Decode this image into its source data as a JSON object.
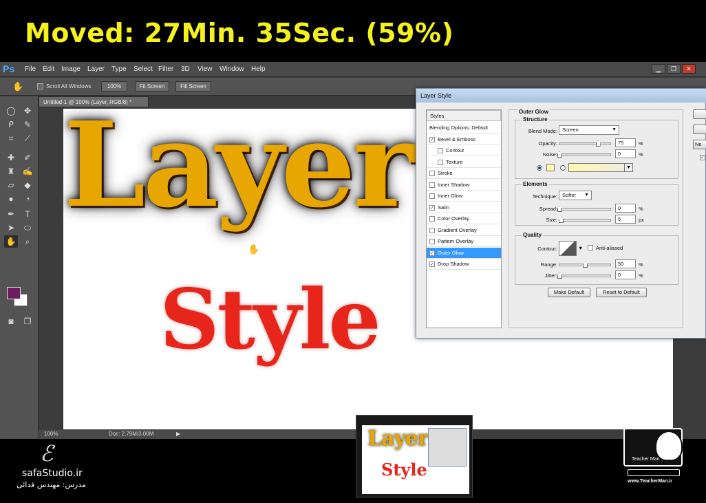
{
  "banner": {
    "text": "Moved: 27Min. 35Sec. (59%)"
  },
  "app": {
    "logo": "Ps",
    "menu": [
      "File",
      "Edit",
      "Image",
      "Layer",
      "Type",
      "Select",
      "Filter",
      "3D",
      "View",
      "Window",
      "Help"
    ],
    "window_buttons": [
      "▁",
      "❐",
      "✕"
    ]
  },
  "options_bar": {
    "scroll_all_windows": "Scroll All Windows",
    "zoom_100": "100%",
    "fit_screen": "Fit Screen",
    "fill_screen": "Fill Screen"
  },
  "document": {
    "tab_title": "Untitled-1 @ 100% (Layer, RGB/8) *",
    "text_top": "Layer",
    "text_bottom": "Style"
  },
  "status_bar": {
    "zoom": "100%",
    "doc_size": "Doc: 2.79M/3.00M",
    "arrow": "▶"
  },
  "colors": {
    "foreground": "#6b1d5e",
    "background": "#ffffff",
    "glow": "#fff9b0"
  },
  "layer_style_dialog": {
    "title": "Layer Style",
    "styles_header": "Styles",
    "items": [
      {
        "label": "Blending Options: Default",
        "checkbox": false,
        "checked": false,
        "indent": 0
      },
      {
        "label": "Bevel & Emboss",
        "checkbox": true,
        "checked": true,
        "indent": 0
      },
      {
        "label": "Contour",
        "checkbox": true,
        "checked": false,
        "indent": 1
      },
      {
        "label": "Texture",
        "checkbox": true,
        "checked": false,
        "indent": 1
      },
      {
        "label": "Stroke",
        "checkbox": true,
        "checked": false,
        "indent": 0
      },
      {
        "label": "Inner Shadow",
        "checkbox": true,
        "checked": false,
        "indent": 0
      },
      {
        "label": "Inner Glow",
        "checkbox": true,
        "checked": false,
        "indent": 0
      },
      {
        "label": "Satin",
        "checkbox": true,
        "checked": true,
        "indent": 0
      },
      {
        "label": "Color Overlay",
        "checkbox": true,
        "checked": false,
        "indent": 0
      },
      {
        "label": "Gradient Overlay",
        "checkbox": true,
        "checked": false,
        "indent": 0
      },
      {
        "label": "Pattern Overlay",
        "checkbox": true,
        "checked": false,
        "indent": 0
      },
      {
        "label": "Outer Glow",
        "checkbox": true,
        "checked": true,
        "indent": 0,
        "selected": true
      },
      {
        "label": "Drop Shadow",
        "checkbox": true,
        "checked": true,
        "indent": 0
      }
    ],
    "outer_glow": {
      "section_title": "Outer Glow",
      "structure_title": "Structure",
      "blend_mode_label": "Blend Mode:",
      "blend_mode_value": "Screen",
      "opacity_label": "Opacity:",
      "opacity_value": "75",
      "opacity_unit": "%",
      "noise_label": "Noise:",
      "noise_value": "0",
      "noise_unit": "%",
      "elements_title": "Elements",
      "technique_label": "Technique:",
      "technique_value": "Softer",
      "spread_label": "Spread:",
      "spread_value": "0",
      "spread_unit": "%",
      "size_label": "Size:",
      "size_value": "5",
      "size_unit": "px",
      "quality_title": "Quality",
      "contour_label": "Contour:",
      "anti_aliased_label": "Anti-aliased",
      "range_label": "Range:",
      "range_value": "50",
      "range_unit": "%",
      "jitter_label": "Jitter:",
      "jitter_value": "0",
      "jitter_unit": "%",
      "make_default": "Make Default",
      "reset_default": "Reset to Default"
    },
    "side_buttons": [
      "",
      "",
      "Ne"
    ]
  },
  "thumbnail": {
    "text_top": "Layer",
    "text_bottom": "Style"
  },
  "branding": {
    "left_name": "safaStudio.ir",
    "left_sub": "مدرس: مهندس فدائی",
    "right_label": "Teacher Man",
    "right_url": "www.TeacherMan.ir"
  }
}
